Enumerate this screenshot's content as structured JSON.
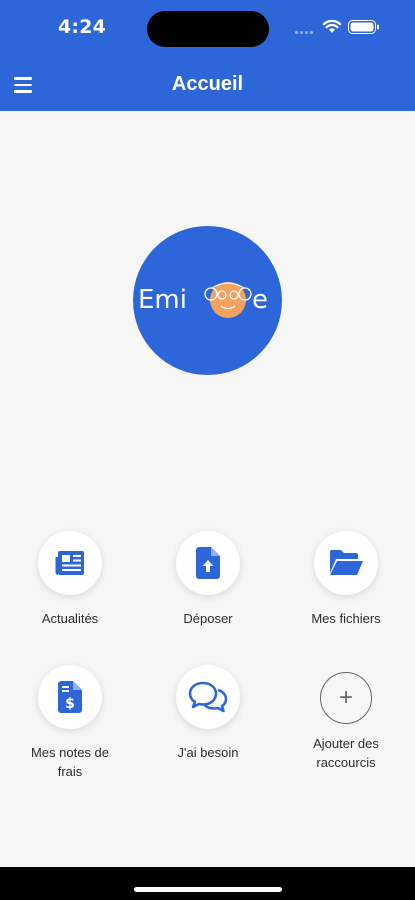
{
  "status": {
    "time": "4:24"
  },
  "header": {
    "title": "Accueil"
  },
  "logo": {
    "text_left": "Emi",
    "text_right": "e"
  },
  "shortcuts": [
    {
      "label": "Actualités",
      "icon": "newspaper-icon"
    },
    {
      "label": "Déposer",
      "icon": "file-upload-icon"
    },
    {
      "label": "Mes fichiers",
      "icon": "folder-open-icon"
    },
    {
      "label": "Mes notes de frais",
      "icon": "receipt-dollar-icon"
    },
    {
      "label": "J'ai besoin",
      "icon": "chat-bubbles-icon"
    },
    {
      "label": "Ajouter des raccourcis",
      "icon": "plus-icon"
    }
  ],
  "colors": {
    "primary": "#2d66d8",
    "background": "#f6f6f6",
    "face": "#f4a261"
  }
}
